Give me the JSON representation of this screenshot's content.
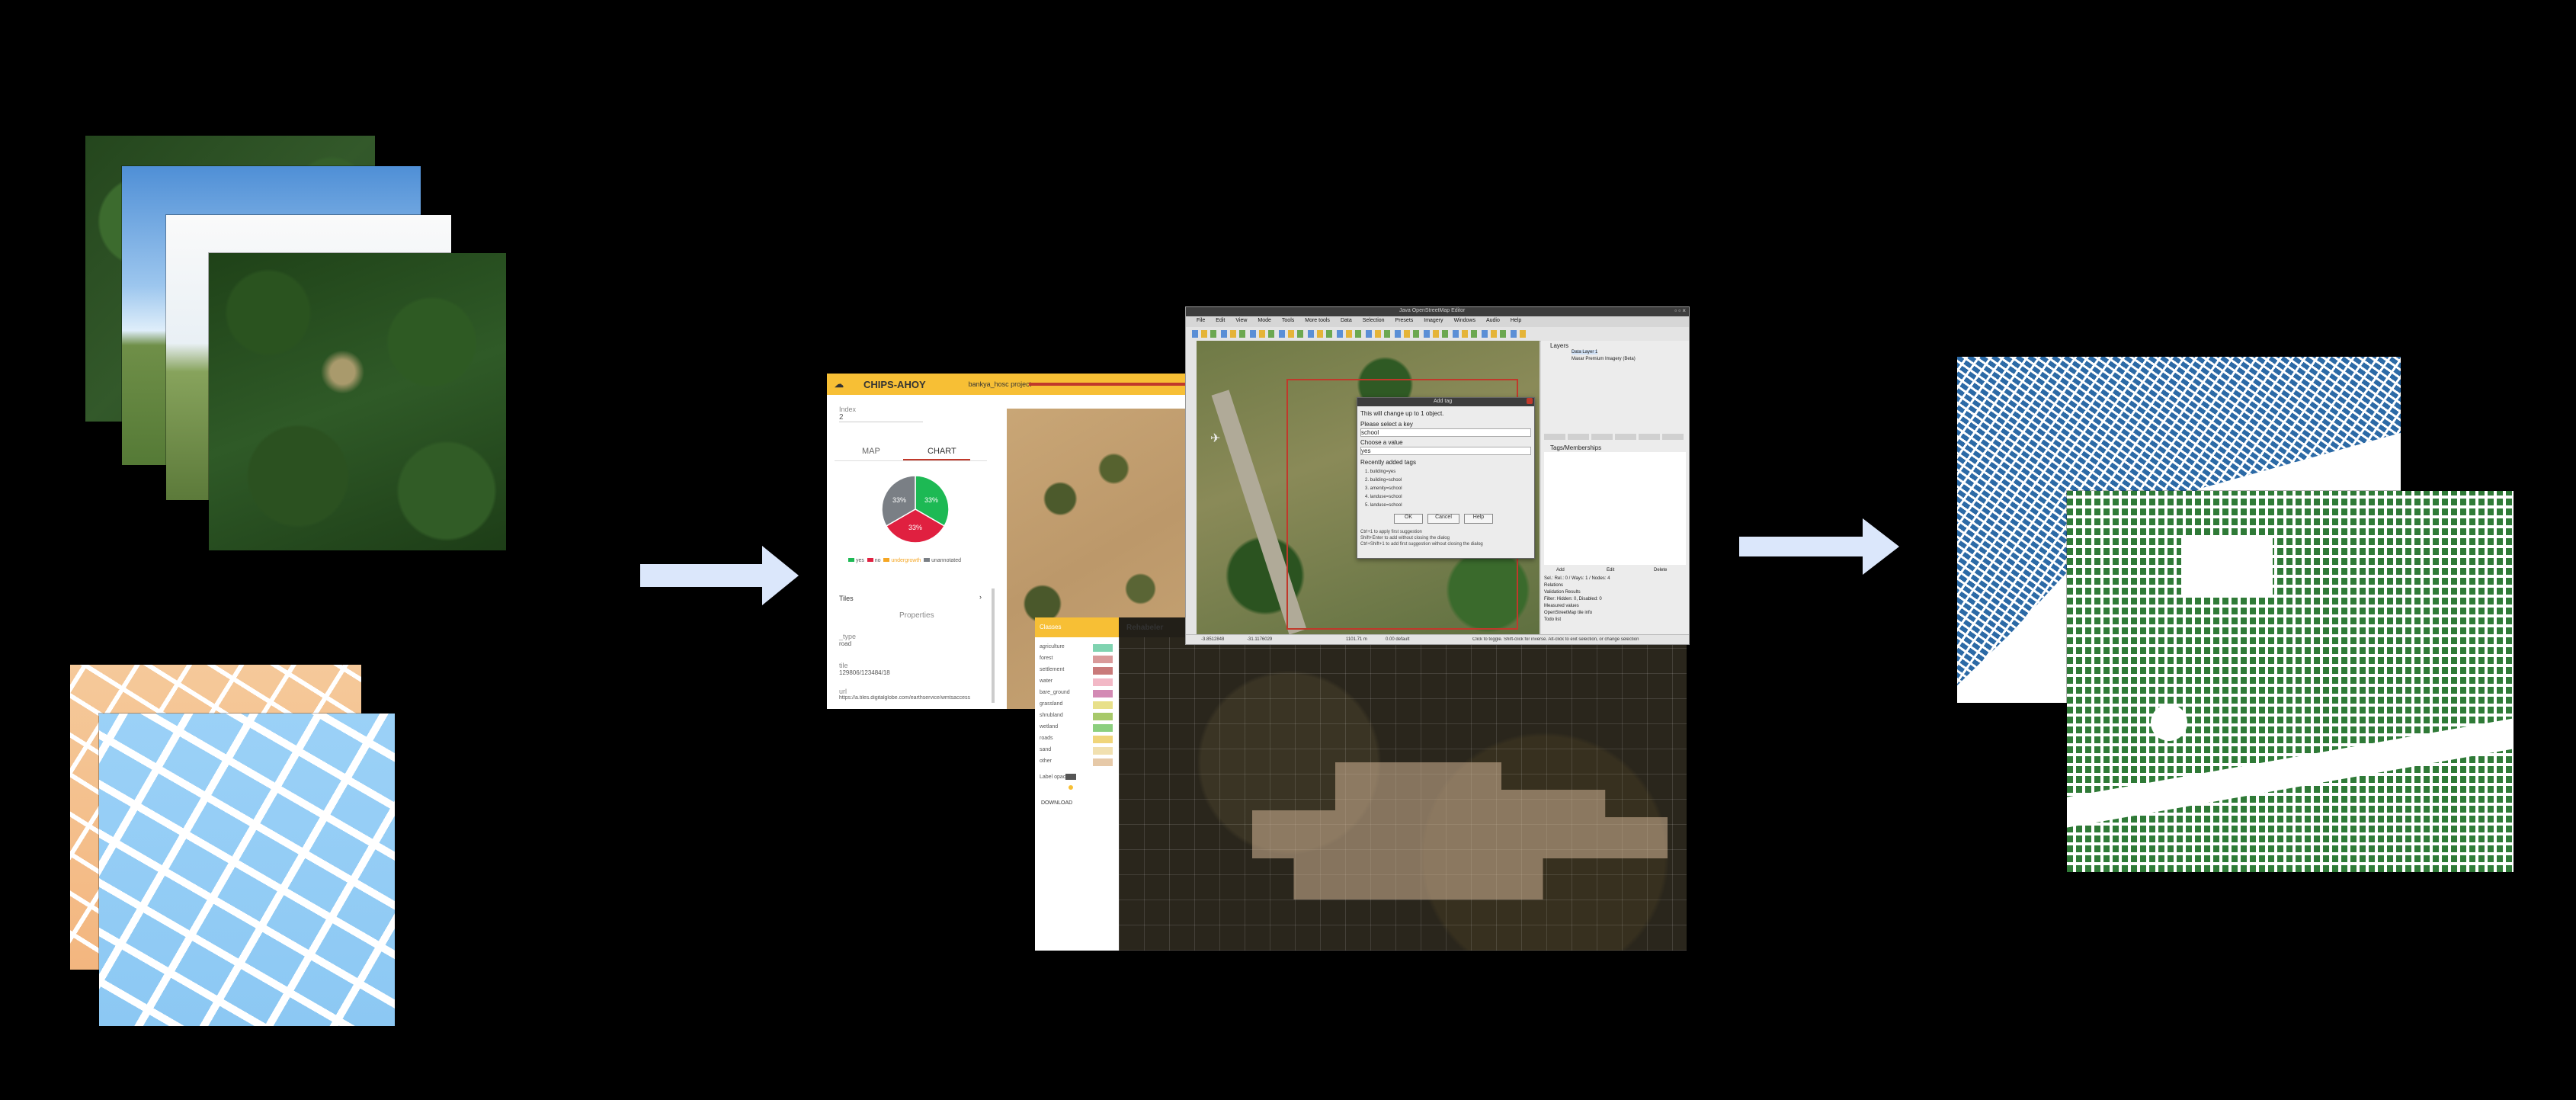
{
  "chips": {
    "app_title": "CHIPS-AHOY",
    "project": "bankya_hosc project",
    "field1_label": "Index",
    "field1_value": "2",
    "tabs": [
      "MAP",
      "CHART"
    ],
    "pie": [
      {
        "label": "yes",
        "percent": 33,
        "color": "#1db954"
      },
      {
        "label": "no",
        "percent": 33,
        "color": "#e02040"
      },
      {
        "label": "undergrowth",
        "percent": 33,
        "color": "#7a7f85"
      }
    ],
    "pie_texts": [
      "33%",
      "33%",
      "33%"
    ],
    "legend": [
      {
        "label": "yes",
        "color": "#1db954"
      },
      {
        "label": "no",
        "color": "#e02040"
      },
      {
        "label": "undergrowth",
        "color": "#f5a623"
      },
      {
        "label": "unannotated",
        "color": "#7a7f85"
      }
    ],
    "section_title": "Tiles",
    "properties_title": "Properties",
    "prop1_label": "_type",
    "prop1_value": "road",
    "prop2_label": "tile",
    "prop2_value": "129806/123484/18",
    "prop3_label": "url",
    "prop3_value": "https://a.tiles.digitalglobe.com/earthservice/wmtsaccess"
  },
  "josm": {
    "title": "Java OpenStreetMap Editor",
    "menu": [
      "File",
      "Edit",
      "View",
      "Mode",
      "Tools",
      "More tools",
      "Data",
      "Selection",
      "Presets",
      "Imagery",
      "Windows",
      "Audio",
      "Help"
    ],
    "dialog": {
      "title": "Add tag",
      "line1": "This will change up to 1 object.",
      "key_label": "Please select a key",
      "key_value": "school",
      "value_label": "Choose a value",
      "value_value": "yes",
      "recent_label": "Recently added tags",
      "recent": [
        "1. building=yes",
        "2. building=school",
        "3. amenity=school",
        "4. landuse=school",
        "5. landuse=school"
      ],
      "ok": "OK",
      "cancel": "Cancel",
      "help": "Help",
      "hint1": "Ctrl+1 to apply first suggestion",
      "hint2": "Shift+Enter to add without closing the dialog",
      "hint3": "Ctrl+Shift+1 to add first suggestion without closing the dialog"
    },
    "layers_title": "Layers",
    "layers": [
      "Data Layer 1",
      "Maxar Premium Imagery (Beta)"
    ],
    "panel2_title": "Tags/Memberships",
    "panel_btns": [
      "Add",
      "Edit",
      "Delete"
    ],
    "sidebar_items": [
      "Sel.: Rel.: 0 / Ways: 1 / Nodes: 4",
      "Relations",
      "Validation Results",
      "Filter: Hidden: 0, Disabled: 0",
      "Measured values",
      "OpenStreetMap tile info",
      "Todo list"
    ],
    "status": [
      "-3.8512848",
      "-31.1176029",
      "1101.71 m",
      "0.00 default"
    ],
    "status_hint": "Click to toggle. Shift-click for inverse. Alt-click to exit selection, or change selection"
  },
  "rehab": {
    "header_left": "Classes",
    "header_right": "Rehabeler",
    "classes": [
      {
        "label": "agriculture",
        "color": "#7fd3b0"
      },
      {
        "label": "forest",
        "color": "#d99a9a"
      },
      {
        "label": "settlement",
        "color": "#c97a7a"
      },
      {
        "label": "water",
        "color": "#f2b8c6"
      },
      {
        "label": "bare_ground",
        "color": "#d38ab4"
      },
      {
        "label": "grassland",
        "color": "#e8e08a"
      },
      {
        "label": "shrubland",
        "color": "#a7c96a"
      },
      {
        "label": "wetland",
        "color": "#8ccf7e"
      },
      {
        "label": "roads",
        "color": "#f0d57a"
      },
      {
        "label": "sand",
        "color": "#f1e0b0"
      },
      {
        "label": "other",
        "color": "#e6c9a8"
      }
    ],
    "label_opacity": "Label opacity",
    "download": "DOWNLOAD"
  }
}
